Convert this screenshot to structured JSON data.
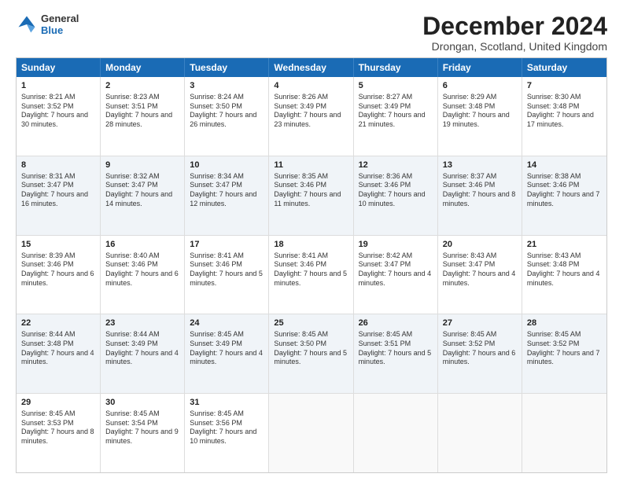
{
  "header": {
    "logo_line1": "General",
    "logo_line2": "Blue",
    "month_title": "December 2024",
    "location": "Drongan, Scotland, United Kingdom"
  },
  "days_of_week": [
    "Sunday",
    "Monday",
    "Tuesday",
    "Wednesday",
    "Thursday",
    "Friday",
    "Saturday"
  ],
  "weeks": [
    [
      {
        "day": "1",
        "sunrise": "8:21 AM",
        "sunset": "3:52 PM",
        "daylight": "7 hours and 30 minutes."
      },
      {
        "day": "2",
        "sunrise": "8:23 AM",
        "sunset": "3:51 PM",
        "daylight": "7 hours and 28 minutes."
      },
      {
        "day": "3",
        "sunrise": "8:24 AM",
        "sunset": "3:50 PM",
        "daylight": "7 hours and 26 minutes."
      },
      {
        "day": "4",
        "sunrise": "8:26 AM",
        "sunset": "3:49 PM",
        "daylight": "7 hours and 23 minutes."
      },
      {
        "day": "5",
        "sunrise": "8:27 AM",
        "sunset": "3:49 PM",
        "daylight": "7 hours and 21 minutes."
      },
      {
        "day": "6",
        "sunrise": "8:29 AM",
        "sunset": "3:48 PM",
        "daylight": "7 hours and 19 minutes."
      },
      {
        "day": "7",
        "sunrise": "8:30 AM",
        "sunset": "3:48 PM",
        "daylight": "7 hours and 17 minutes."
      }
    ],
    [
      {
        "day": "8",
        "sunrise": "8:31 AM",
        "sunset": "3:47 PM",
        "daylight": "7 hours and 16 minutes."
      },
      {
        "day": "9",
        "sunrise": "8:32 AM",
        "sunset": "3:47 PM",
        "daylight": "7 hours and 14 minutes."
      },
      {
        "day": "10",
        "sunrise": "8:34 AM",
        "sunset": "3:47 PM",
        "daylight": "7 hours and 12 minutes."
      },
      {
        "day": "11",
        "sunrise": "8:35 AM",
        "sunset": "3:46 PM",
        "daylight": "7 hours and 11 minutes."
      },
      {
        "day": "12",
        "sunrise": "8:36 AM",
        "sunset": "3:46 PM",
        "daylight": "7 hours and 10 minutes."
      },
      {
        "day": "13",
        "sunrise": "8:37 AM",
        "sunset": "3:46 PM",
        "daylight": "7 hours and 8 minutes."
      },
      {
        "day": "14",
        "sunrise": "8:38 AM",
        "sunset": "3:46 PM",
        "daylight": "7 hours and 7 minutes."
      }
    ],
    [
      {
        "day": "15",
        "sunrise": "8:39 AM",
        "sunset": "3:46 PM",
        "daylight": "7 hours and 6 minutes."
      },
      {
        "day": "16",
        "sunrise": "8:40 AM",
        "sunset": "3:46 PM",
        "daylight": "7 hours and 6 minutes."
      },
      {
        "day": "17",
        "sunrise": "8:41 AM",
        "sunset": "3:46 PM",
        "daylight": "7 hours and 5 minutes."
      },
      {
        "day": "18",
        "sunrise": "8:41 AM",
        "sunset": "3:46 PM",
        "daylight": "7 hours and 5 minutes."
      },
      {
        "day": "19",
        "sunrise": "8:42 AM",
        "sunset": "3:47 PM",
        "daylight": "7 hours and 4 minutes."
      },
      {
        "day": "20",
        "sunrise": "8:43 AM",
        "sunset": "3:47 PM",
        "daylight": "7 hours and 4 minutes."
      },
      {
        "day": "21",
        "sunrise": "8:43 AM",
        "sunset": "3:48 PM",
        "daylight": "7 hours and 4 minutes."
      }
    ],
    [
      {
        "day": "22",
        "sunrise": "8:44 AM",
        "sunset": "3:48 PM",
        "daylight": "7 hours and 4 minutes."
      },
      {
        "day": "23",
        "sunrise": "8:44 AM",
        "sunset": "3:49 PM",
        "daylight": "7 hours and 4 minutes."
      },
      {
        "day": "24",
        "sunrise": "8:45 AM",
        "sunset": "3:49 PM",
        "daylight": "7 hours and 4 minutes."
      },
      {
        "day": "25",
        "sunrise": "8:45 AM",
        "sunset": "3:50 PM",
        "daylight": "7 hours and 5 minutes."
      },
      {
        "day": "26",
        "sunrise": "8:45 AM",
        "sunset": "3:51 PM",
        "daylight": "7 hours and 5 minutes."
      },
      {
        "day": "27",
        "sunrise": "8:45 AM",
        "sunset": "3:52 PM",
        "daylight": "7 hours and 6 minutes."
      },
      {
        "day": "28",
        "sunrise": "8:45 AM",
        "sunset": "3:52 PM",
        "daylight": "7 hours and 7 minutes."
      }
    ],
    [
      {
        "day": "29",
        "sunrise": "8:45 AM",
        "sunset": "3:53 PM",
        "daylight": "7 hours and 8 minutes."
      },
      {
        "day": "30",
        "sunrise": "8:45 AM",
        "sunset": "3:54 PM",
        "daylight": "7 hours and 9 minutes."
      },
      {
        "day": "31",
        "sunrise": "8:45 AM",
        "sunset": "3:56 PM",
        "daylight": "7 hours and 10 minutes."
      },
      null,
      null,
      null,
      null
    ]
  ]
}
